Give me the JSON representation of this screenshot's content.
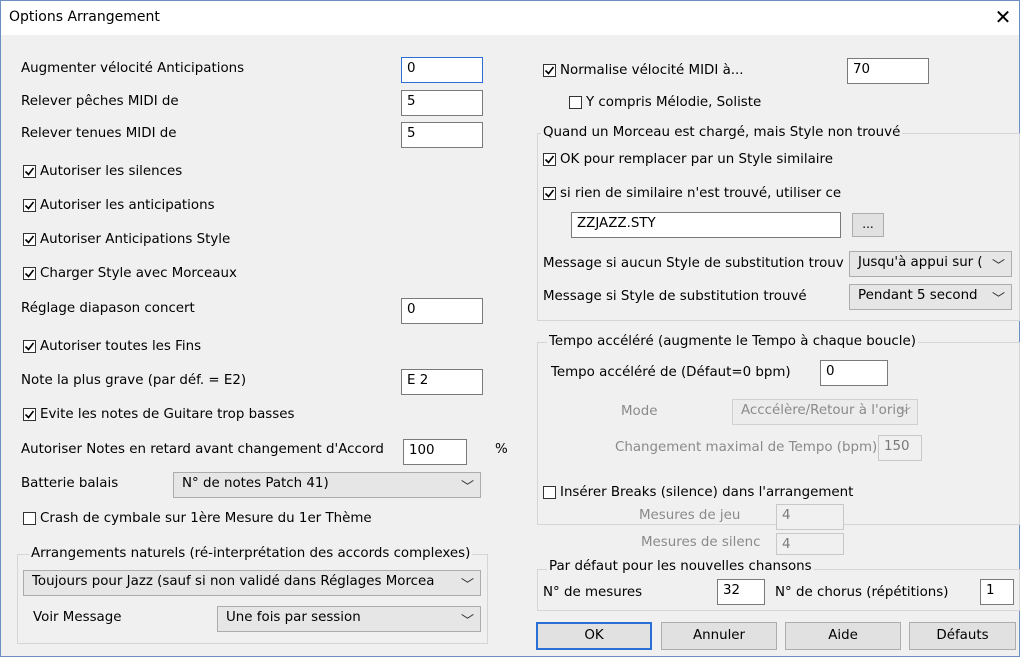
{
  "window": {
    "title": "Options Arrangement"
  },
  "left": {
    "anticipation_velocity": {
      "label": "Augmenter vélocité Anticipations",
      "value": "0"
    },
    "raise_midi_peaks": {
      "label": "Relever pêches MIDI de",
      "value": "5"
    },
    "raise_midi_holds": {
      "label": "Relever tenues MIDI de",
      "value": "5"
    },
    "allow_rests": {
      "label": "Autoriser les silences",
      "checked": true
    },
    "allow_anticipations": {
      "label": "Autoriser les anticipations",
      "checked": true
    },
    "allow_style_anticipations": {
      "label": "Autoriser Anticipations Style",
      "checked": true
    },
    "load_style_with_songs": {
      "label": "Charger Style avec Morceaux",
      "checked": true
    },
    "concert_pitch": {
      "label": "Réglage diapason concert",
      "value": "0"
    },
    "allow_all_endings": {
      "label": "Autoriser toutes les Fins",
      "checked": true
    },
    "lowest_note": {
      "label": "Note la plus grave (par déf. = E2)",
      "value": "E 2"
    },
    "avoid_low_guitar": {
      "label": "Evite les notes de Guitare trop basses",
      "checked": true
    },
    "late_notes": {
      "label": "Autoriser Notes en retard avant changement d'Accord",
      "value": "100",
      "unit": "%"
    },
    "brush_drums": {
      "label": "Batterie balais",
      "selected": "N° de notes Patch 41)"
    },
    "crash_cymbal": {
      "label": "Crash de cymbale sur 1ère Mesure du 1er Thème",
      "checked": false
    },
    "natural_group": {
      "title": "Arrangements naturels (ré-interprétation des accords complexes)",
      "mode_selected": "Toujours pour Jazz (sauf si non validé dans Réglages Morcea",
      "see_message_label": "Voir Message",
      "see_message_selected": "Une fois par session"
    }
  },
  "right": {
    "normalize_velocity": {
      "label": "Normalise vélocité MIDI à...",
      "checked": true,
      "value": "70"
    },
    "include_melody": {
      "label": "Y compris Mélodie, Soliste",
      "checked": false
    },
    "style_not_found_group": {
      "title": "Quand un Morceau est chargé, mais Style non trouvé",
      "ok_replace": {
        "label": "OK pour remplacer par un Style similaire",
        "checked": true
      },
      "if_none_use": {
        "label": "si rien de similaire n'est trouvé, utiliser ce",
        "checked": true
      },
      "style_file": "ZZJAZZ.STY",
      "browse_label": "...",
      "msg_none_label": "Message si aucun Style de substitution trouv",
      "msg_none_selected": "Jusqu'à appui sur (",
      "msg_found_label": "Message si Style de substitution trouvé",
      "msg_found_selected": "Pendant 5 second"
    },
    "tempo_group": {
      "title": "Tempo accéléré (augmente le Tempo à chaque boucle)",
      "accel_label": "Tempo accéléré de (Défaut=0 bpm)",
      "accel_value": "0",
      "mode_label": "Mode",
      "mode_selected": "Acccélère/Retour à l'origi",
      "max_change_label": "Changement maximal de Tempo (bpm)",
      "max_change_value": "150"
    },
    "insert_breaks": {
      "label": "Insérer Breaks (silence) dans l'arrangement",
      "checked": false
    },
    "play_bars": {
      "label": "Mesures de jeu",
      "value": "4"
    },
    "silence_bars": {
      "label": "Mesures de silenc",
      "value": "4"
    },
    "defaults_group": {
      "title": "Par défaut pour les nouvelles chansons",
      "bars_label": "N° de mesures",
      "bars_value": "32",
      "choruses_label": "N° de chorus (répétitions)",
      "choruses_value": "1"
    }
  },
  "buttons": {
    "ok": "OK",
    "cancel": "Annuler",
    "help": "Aide",
    "defaults": "Défauts"
  }
}
